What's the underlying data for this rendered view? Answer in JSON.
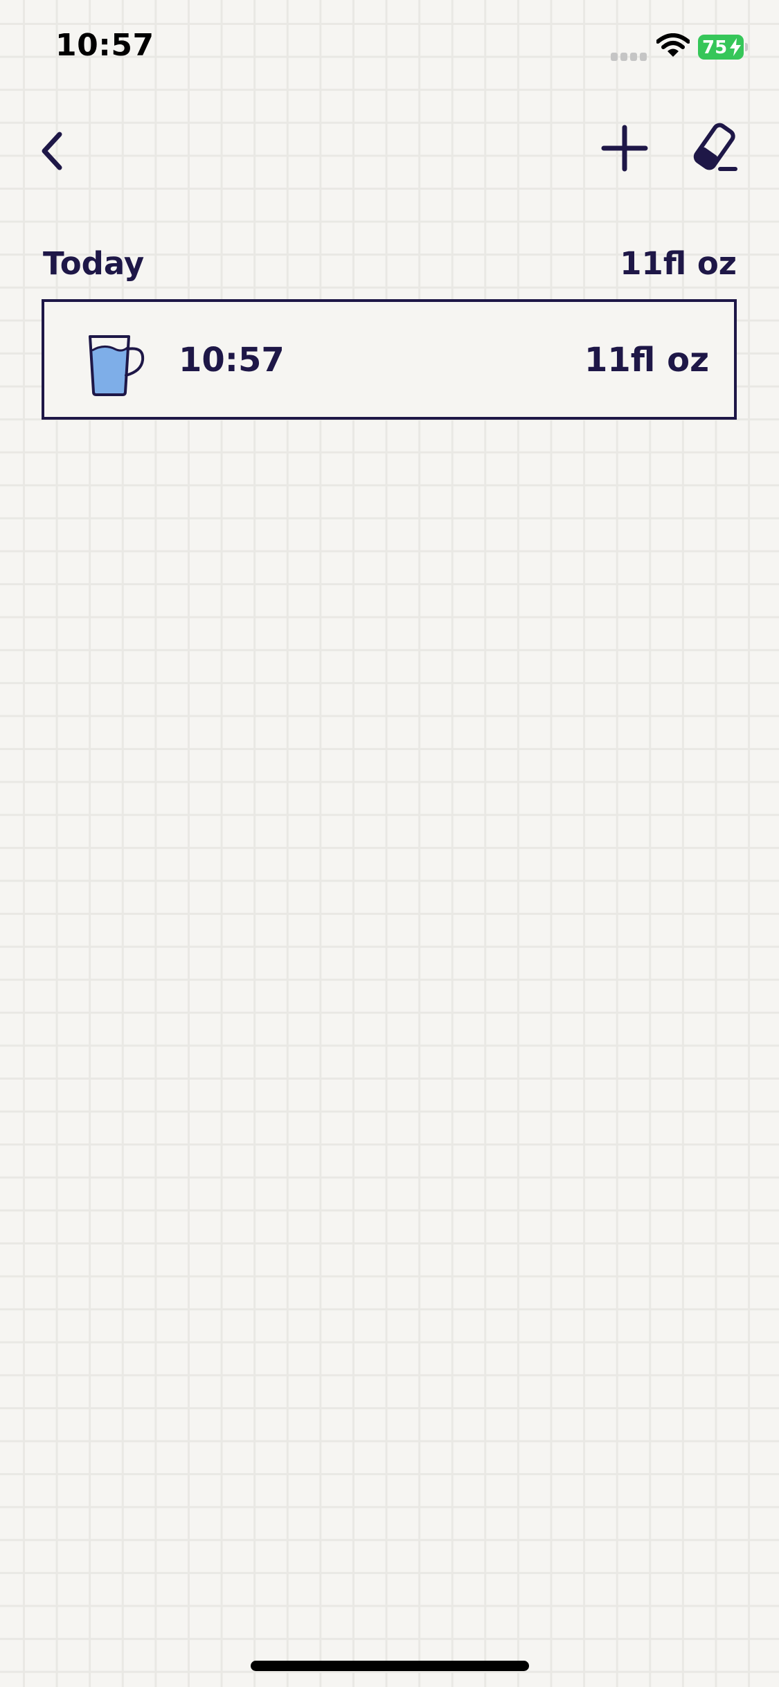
{
  "status_bar": {
    "time": "10:57",
    "battery_level": "75",
    "signal_icon": "cellular-signal-icon",
    "wifi_icon": "wifi-icon",
    "battery_icon": "battery-charging-icon"
  },
  "nav": {
    "back_icon": "chevron-left-icon",
    "add_icon": "plus-icon",
    "edit_icon": "eraser-icon"
  },
  "section": {
    "title": "Today",
    "total": "11fl oz"
  },
  "entries": [
    {
      "icon": "water-cup-icon",
      "time": "10:57",
      "amount": "11fl oz"
    }
  ],
  "colors": {
    "ink": "#1e1747",
    "background": "#f6f5f2",
    "grid": "#e9e8e4",
    "water": "#7eaee8",
    "battery": "#36c659"
  }
}
